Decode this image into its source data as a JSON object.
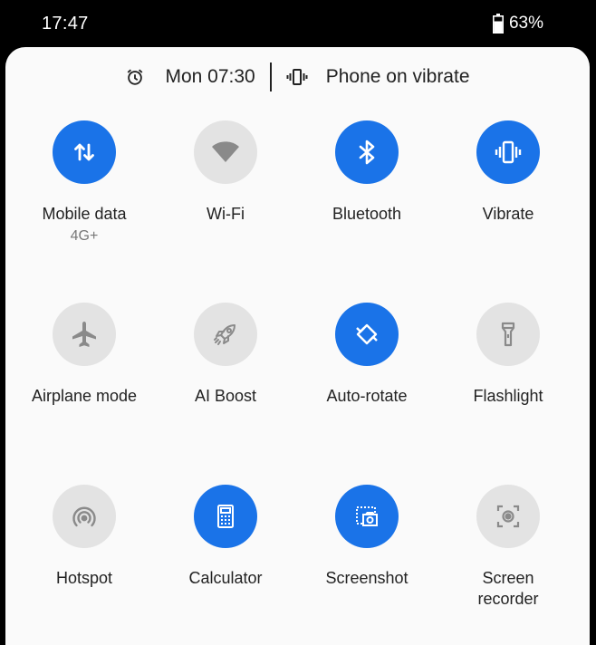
{
  "status_bar": {
    "time": "17:47",
    "battery": "63%"
  },
  "info_row": {
    "alarm": "Mon 07:30",
    "ringer": "Phone on vibrate"
  },
  "colors": {
    "active": "#1a73e8",
    "inactive": "#e3e3e3",
    "panel": "#fafafa"
  },
  "tiles": [
    {
      "label": "Mobile data",
      "sublabel": "4G+",
      "active": true,
      "icon": "mobile-data-icon"
    },
    {
      "label": "Wi-Fi",
      "active": false,
      "icon": "wifi-icon"
    },
    {
      "label": "Bluetooth",
      "active": true,
      "icon": "bluetooth-icon"
    },
    {
      "label": "Vibrate",
      "active": true,
      "icon": "vibrate-icon"
    },
    {
      "label": "Airplane mode",
      "active": false,
      "icon": "airplane-icon"
    },
    {
      "label": "AI Boost",
      "active": false,
      "icon": "rocket-icon"
    },
    {
      "label": "Auto-rotate",
      "active": true,
      "icon": "auto-rotate-icon"
    },
    {
      "label": "Flashlight",
      "active": false,
      "icon": "flashlight-icon"
    },
    {
      "label": "Hotspot",
      "active": false,
      "icon": "hotspot-icon"
    },
    {
      "label": "Calculator",
      "active": true,
      "icon": "calculator-icon"
    },
    {
      "label": "Screenshot",
      "active": true,
      "icon": "screenshot-icon"
    },
    {
      "label": "Screen\nrecorder",
      "active": false,
      "icon": "screen-recorder-icon"
    }
  ]
}
